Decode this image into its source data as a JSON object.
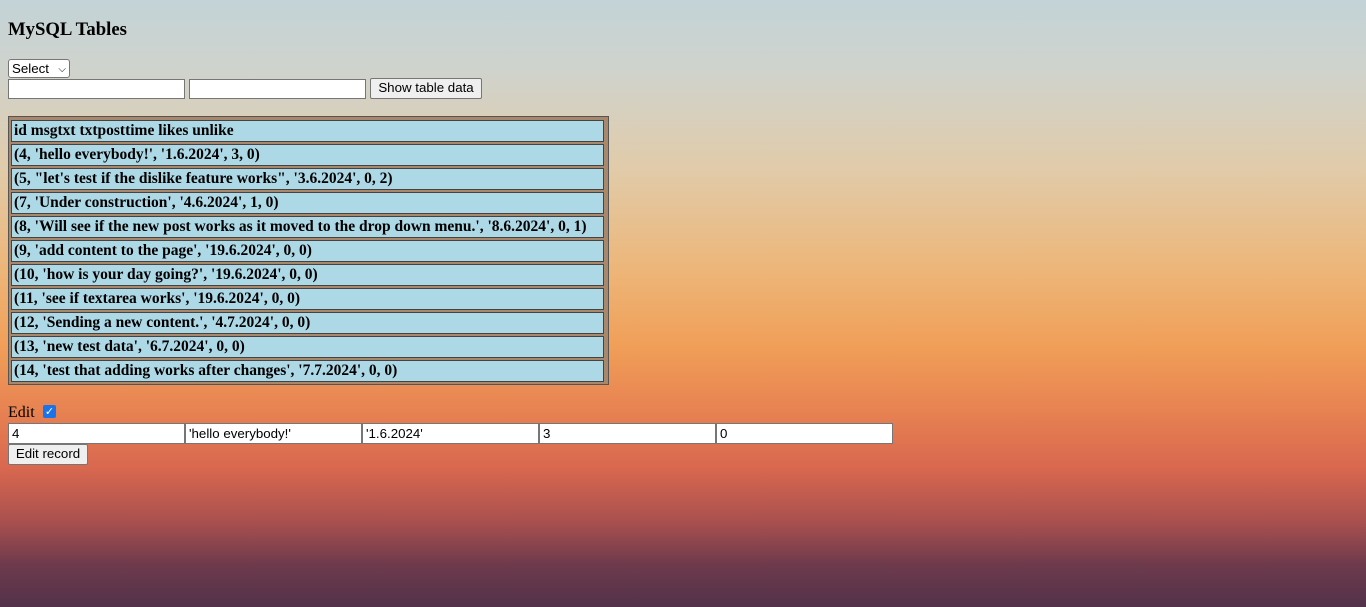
{
  "page_title": "MySQL Tables",
  "select": {
    "value": "Select"
  },
  "show_button_label": "Show table data",
  "table_rows": [
    "id msgtxt txtposttime likes unlike",
    "(4, 'hello everybody!', '1.6.2024', 3, 0)",
    "(5, \"let's test if the dislike feature works\", '3.6.2024', 0, 2)",
    "(7, 'Under construction', '4.6.2024', 1, 0)",
    "(8, 'Will see if the new post works as it moved to the drop down menu.', '8.6.2024', 0, 1)",
    "(9, 'add content to the page', '19.6.2024', 0, 0)",
    "(10, 'how is your day going?', '19.6.2024', 0, 0)",
    "(11, 'see if textarea works', '19.6.2024', 0, 0)",
    "(12, 'Sending a new content.', '4.7.2024', 0, 0)",
    "(13, 'new test data', '6.7.2024', 0, 0)",
    "(14, 'test that adding works after changes', '7.7.2024', 0, 0)"
  ],
  "edit": {
    "label": "Edit",
    "checked": true,
    "fields": [
      "4",
      "'hello everybody!'",
      "'1.6.2024'",
      "3",
      "0"
    ],
    "button_label": "Edit record"
  }
}
